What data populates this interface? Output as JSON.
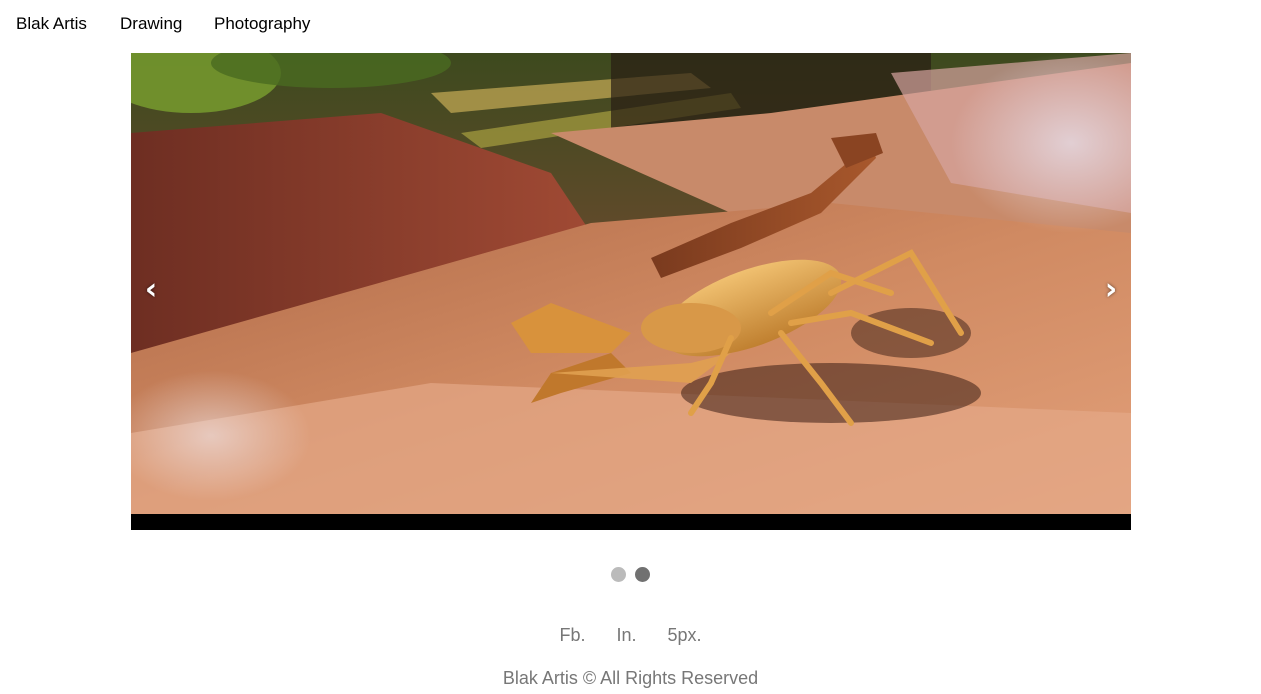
{
  "nav": {
    "brand": "Blak Artis",
    "items": [
      {
        "label": "Drawing"
      },
      {
        "label": "Photography"
      }
    ]
  },
  "carousel": {
    "prev_glyph": "‹",
    "next_glyph": "›",
    "slide_count": 2,
    "active_index": 1,
    "slide_subject": "scorpion-photo"
  },
  "social": {
    "links": [
      "Fb.",
      "In.",
      "5px."
    ]
  },
  "footer": {
    "text": "Blak Artis © All Rights Reserved"
  },
  "colors": {
    "dot_inactive": "#bbbbbb",
    "dot_active": "#717171",
    "muted_text": "#777777"
  }
}
